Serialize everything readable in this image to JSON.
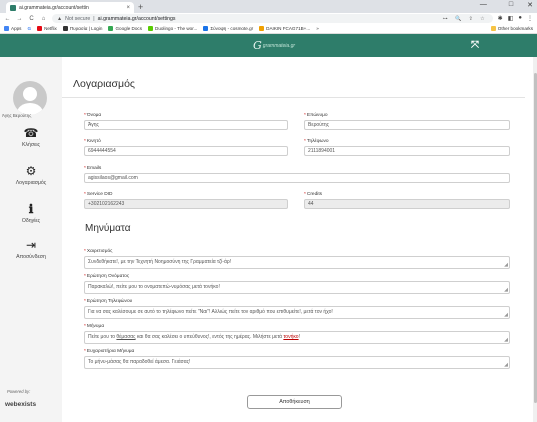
{
  "browser": {
    "tab_title": "ai.grammateia.gr/account/settin",
    "tab_close": "×",
    "new_tab": "+",
    "win_minimize": "—",
    "win_restore": "□",
    "win_close": "✕",
    "nav": {
      "back": "←",
      "forward": "→",
      "reload": "C",
      "home": "⌂"
    },
    "security_label": "Not secure",
    "url": "ai.grammateia.gr/account/settings",
    "bookmarks": [
      {
        "label": "Apps",
        "color": "#4285f4"
      },
      {
        "label": "G",
        "color": "#ffffff"
      },
      {
        "label": "Netflix",
        "color": "#e50914"
      },
      {
        "label": "Πυρασία | Login",
        "color": "#333333"
      },
      {
        "label": "Google Docs",
        "color": "#34a853"
      },
      {
        "label": "Duolingo - The wor...",
        "color": "#58cc02"
      },
      {
        "label": "Σύνοψη - cosmote.gr",
        "color": "#1a73e8"
      },
      {
        "label": "DAIKIN FCAG71B+...",
        "color": "#f0a000"
      },
      {
        "label": "»",
        "color": "#ffffff"
      }
    ],
    "other_bookmarks": "Other bookmarks"
  },
  "header": {
    "logo_mark": "G",
    "logo_text": "grammateia.gr",
    "expand_icon": "⤧"
  },
  "sidebar": {
    "username": "Άγης Βερούτης",
    "items": [
      {
        "label": "Κλήσεις",
        "icon": "☎"
      },
      {
        "label": "Λογαριασμός",
        "icon": "⚙"
      },
      {
        "label": "Οδηγίες",
        "icon": "ℹ"
      },
      {
        "label": "Αποσύνδεση",
        "icon": "⇥"
      }
    ],
    "powered_by": "Powered by:",
    "brand": "webexists"
  },
  "page": {
    "title": "Λογαριασμός",
    "fields": {
      "first_name": {
        "label": "Όνομα",
        "value": "Άγης"
      },
      "last_name": {
        "label": "Επώνυμο",
        "value": "Βερούτης"
      },
      "mobile": {
        "label": "Κινητό",
        "value": "6944444554"
      },
      "phone": {
        "label": "Τηλέφωνο",
        "value": "2111894001"
      },
      "emails": {
        "label": "Emails",
        "value": "agissilaos@gmail.com"
      },
      "service_did": {
        "label": "Service DID",
        "value": "+302102162243"
      },
      "credits": {
        "label": "Credits",
        "value": "44"
      }
    },
    "messages_title": "Μηνύματα",
    "messages": {
      "greeting": {
        "label": "Χαιρετισμός",
        "value": "Συνδεθήκατε!, με την Τεχνητή Νοημοσύνη της Γραμματεία τζί-άρ!"
      },
      "ask_name": {
        "label": "Ερώτηση Ονόματος",
        "value": "Παρακαλώ!, πείτε μου το ονοματεπώ-νυμόσας μετά τονήκο!"
      },
      "ask_phone": {
        "label": "Ερώτηση Τηλεφώνου",
        "value": "Για να σας καλέσουμε σε αυτό το τηλέφωνο πείτε \"Ναι\"! Αλλιώς πείτε τον αριθμό που επιθυμείτε!, μετά τον ήχο!"
      },
      "message": {
        "label": "Μήνυμα",
        "value_before": "Πείτε μου το ",
        "link1": "θέμασας",
        "value_middle": " και θα σας καλέσει ο υπεύθυνος!, εντός της ημέρας. Μιλήστε μετά ",
        "link2": "τονήκο",
        "value_after": "!"
      },
      "thanks": {
        "label": "Ευχαριστήρια Μήνυμα",
        "value": "Το μήνυ-μάσας θα παραδοθεί άμεσα. Γειάσας!"
      }
    },
    "save_label": "Αποθήκευση",
    "required_mark": "*"
  }
}
